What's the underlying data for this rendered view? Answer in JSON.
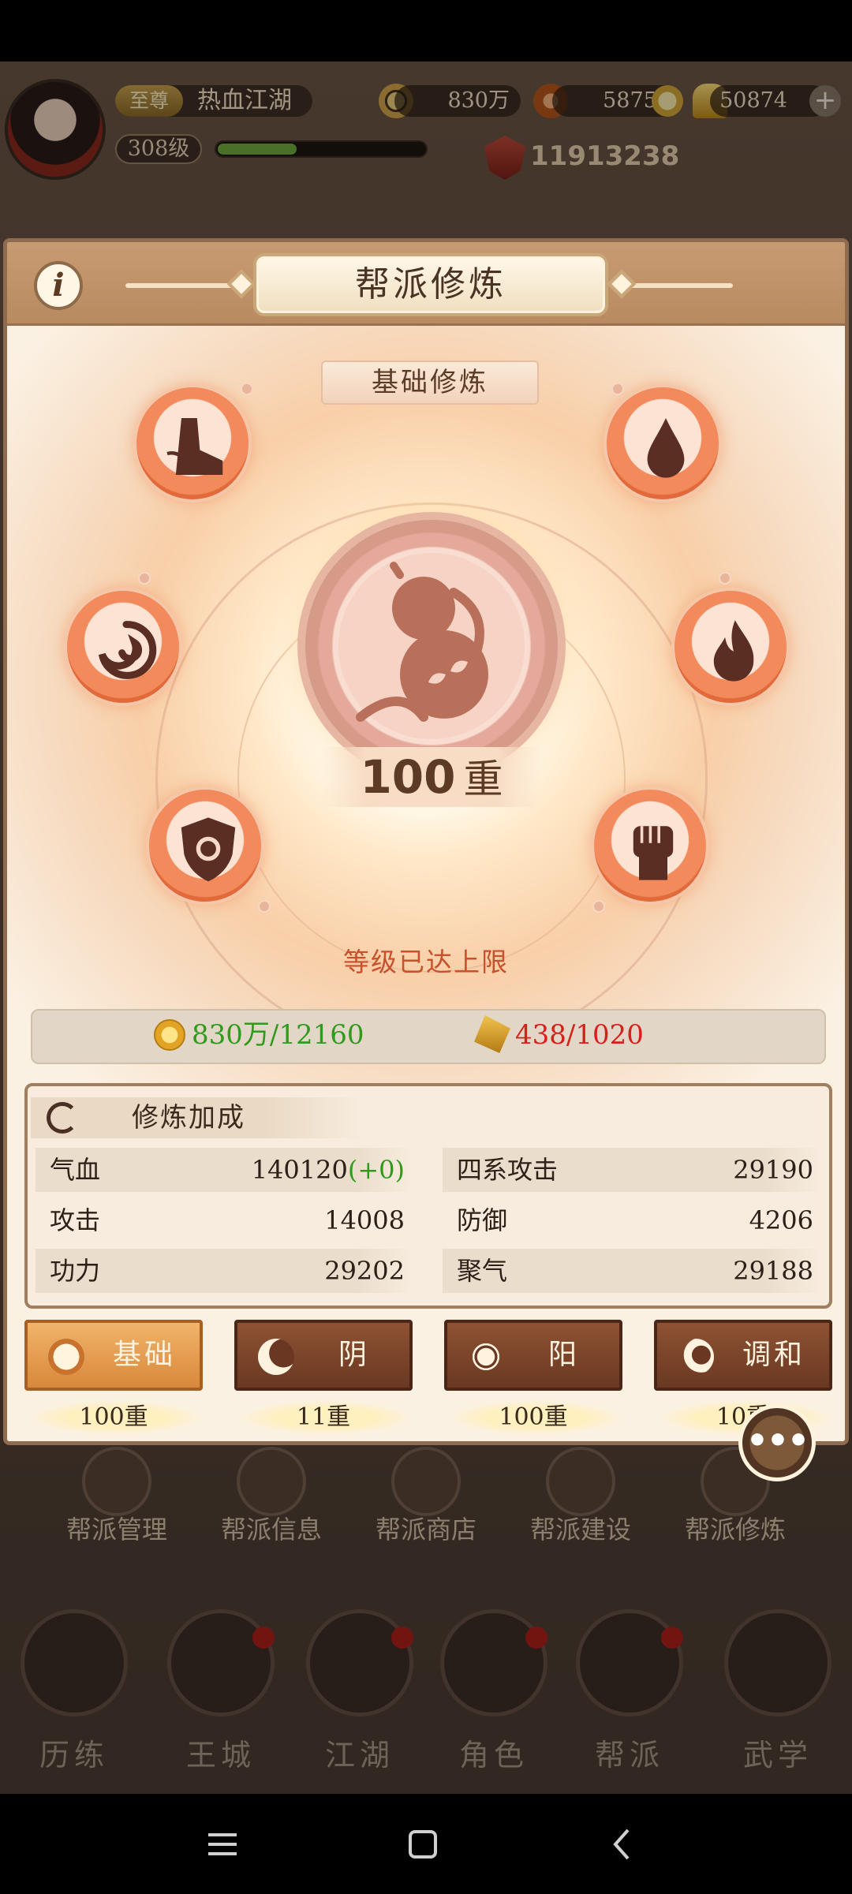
{
  "player": {
    "vip_label": "至尊",
    "name": "热血江湖",
    "level": "308级",
    "exp_fraction": 0.38,
    "power": "11913238"
  },
  "resources": {
    "coins": "830万",
    "gems": "58759",
    "gold": "50874"
  },
  "panel": {
    "title": "帮派修炼",
    "subtitle": "基础修炼",
    "level_number": "100",
    "level_unit": "重",
    "max_text": "等级已达上限",
    "cost_coins": "830万/12160",
    "cost_tokens": "438/1020"
  },
  "bonus": {
    "title": "修炼加成",
    "left": [
      {
        "name": "气血",
        "value": "140120",
        "delta": "(+0)"
      },
      {
        "name": "攻击",
        "value": "14008",
        "delta": ""
      },
      {
        "name": "功力",
        "value": "29202",
        "delta": ""
      }
    ],
    "right": [
      {
        "name": "四系攻击",
        "value": "29190"
      },
      {
        "name": "防御",
        "value": "4206"
      },
      {
        "name": "聚气",
        "value": "29188"
      }
    ]
  },
  "tabs": [
    {
      "label": "基础",
      "level": "100重",
      "icon": "gourd-icon",
      "active": true
    },
    {
      "label": "阴",
      "level": "11重",
      "icon": "moon-icon",
      "active": false
    },
    {
      "label": "阳",
      "level": "100重",
      "icon": "sun-icon",
      "active": false
    },
    {
      "label": "调和",
      "level": "10重",
      "icon": "sun-moon-icon",
      "active": false
    }
  ],
  "orbs": [
    "boot-icon",
    "blood-drop-icon",
    "swirl-icon",
    "flame-icon",
    "shield-icon",
    "fist-icon"
  ],
  "guild_menu": [
    "帮派管理",
    "帮派信息",
    "帮派商店",
    "帮派建设",
    "帮派修炼"
  ],
  "bottom_nav": [
    "历练",
    "王城",
    "江湖",
    "角色",
    "帮派",
    "武学"
  ],
  "colors": {
    "panel_bg": "#fbf1e3",
    "header": "#b88a60",
    "orb": "#e26a3a",
    "max_text": "#c8502b",
    "cost_green": "#2f9a1c",
    "cost_red": "#d6201c",
    "tab_active": "#d8883a",
    "tab_inactive": "#6a3822"
  }
}
